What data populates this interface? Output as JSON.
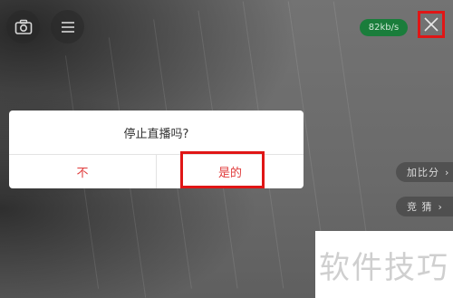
{
  "top_bar": {
    "bitrate": "82kb/s"
  },
  "dialog": {
    "title": "停止直播吗?",
    "cancel_label": "不",
    "confirm_label": "是的"
  },
  "side_pills": [
    "加比分",
    "竞 猜"
  ],
  "watermark": "软件技巧",
  "colors": {
    "accent_red": "#e03b3b",
    "badge_green": "#1a7d3b",
    "annotation_red": "#e01616"
  }
}
